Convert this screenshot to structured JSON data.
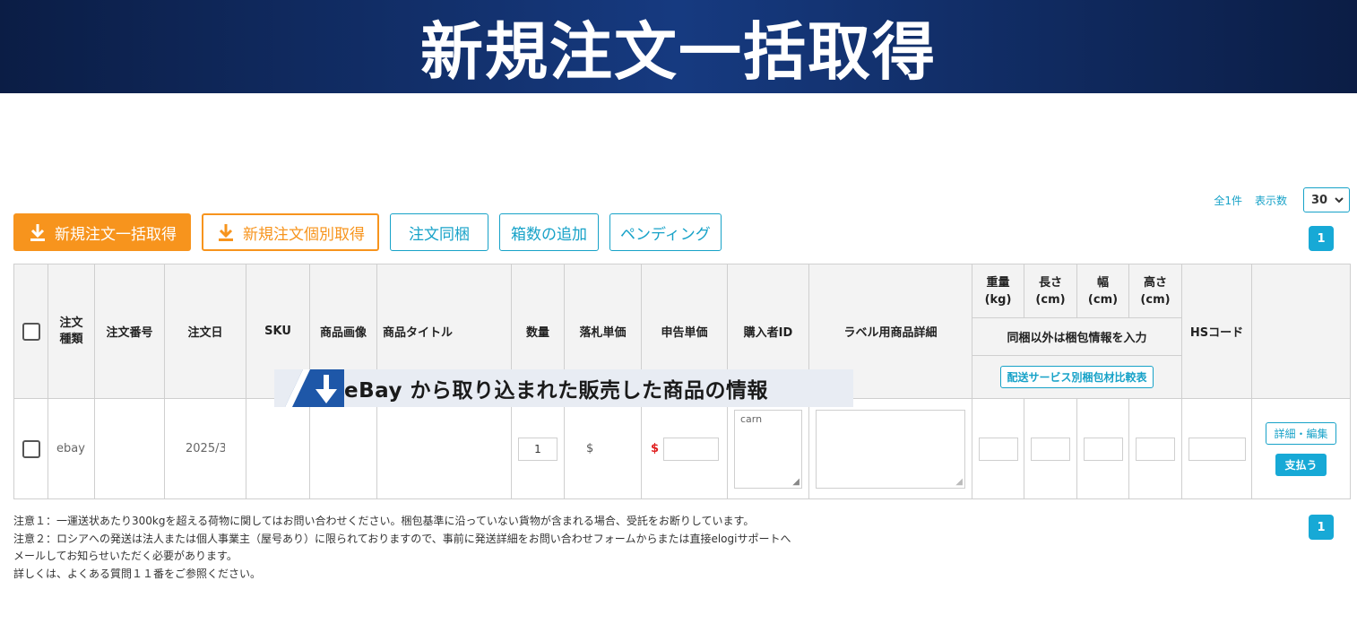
{
  "banner": {
    "title": "新規注文一括取得"
  },
  "pagination": {
    "total": "全1件",
    "display_label": "表示数",
    "per_page": "30",
    "page_top": "1",
    "page_bottom": "1"
  },
  "actions": {
    "bulk_fetch": "新規注文一括取得",
    "single_fetch": "新規注文個別取得",
    "combine": "注文同梱",
    "add_boxes": "箱数の追加",
    "pending": "ペンディング"
  },
  "table": {
    "headers": {
      "order_type": "注文種類",
      "order_number": "注文番号",
      "order_date": "注文日",
      "sku": "SKU",
      "image": "商品画像",
      "title": "商品タイトル",
      "quantity": "数量",
      "bid_price": "落札単価",
      "declared_price": "申告単価",
      "buyer_id": "購入者ID",
      "label_detail": "ラベル用商品詳細",
      "weight": "重量(kg)",
      "length": "長さ(cm)",
      "width": "幅(cm)",
      "height": "高さ(cm)",
      "package_note": "同梱以外は梱包情報を入力",
      "compare_button": "配送サービス別梱包材比較表",
      "hs_code": "HSコード"
    },
    "rows": [
      {
        "order_type": "ebay",
        "order_number": "",
        "order_date": "2025/3",
        "quantity": "1",
        "bid_price": "$",
        "declared_currency": "$",
        "buyer_id": "carn",
        "detail_button": "詳細・編集",
        "pay_button": "支払う"
      }
    ]
  },
  "overlay": {
    "text": "eBay から取り込まれた販売した商品の情報"
  },
  "notes": [
    "注意１：一運送状あたり300kgを超える荷物に関してはお問い合わせください。梱包基準に沿っていない貨物が含まれる場合、受託をお断りしています。",
    "注意２：ロシアへの発送は法人または個人事業主（屋号あり）に限られておりますので、事前に発送詳細をお問い合わせフォームからまたは直接elogiサポートへ",
    "メールしてお知らせいただく必要があります。",
    "詳しくは、よくある質問１１番をご参照ください。"
  ],
  "colors": {
    "banner_bg": "#163a80",
    "orange": "#f7941d",
    "teal": "#17a2c8",
    "pay_blue": "#17a9d6"
  },
  "icons": [
    "download-icon",
    "chevron-down-icon",
    "down-arrow-icon"
  ]
}
